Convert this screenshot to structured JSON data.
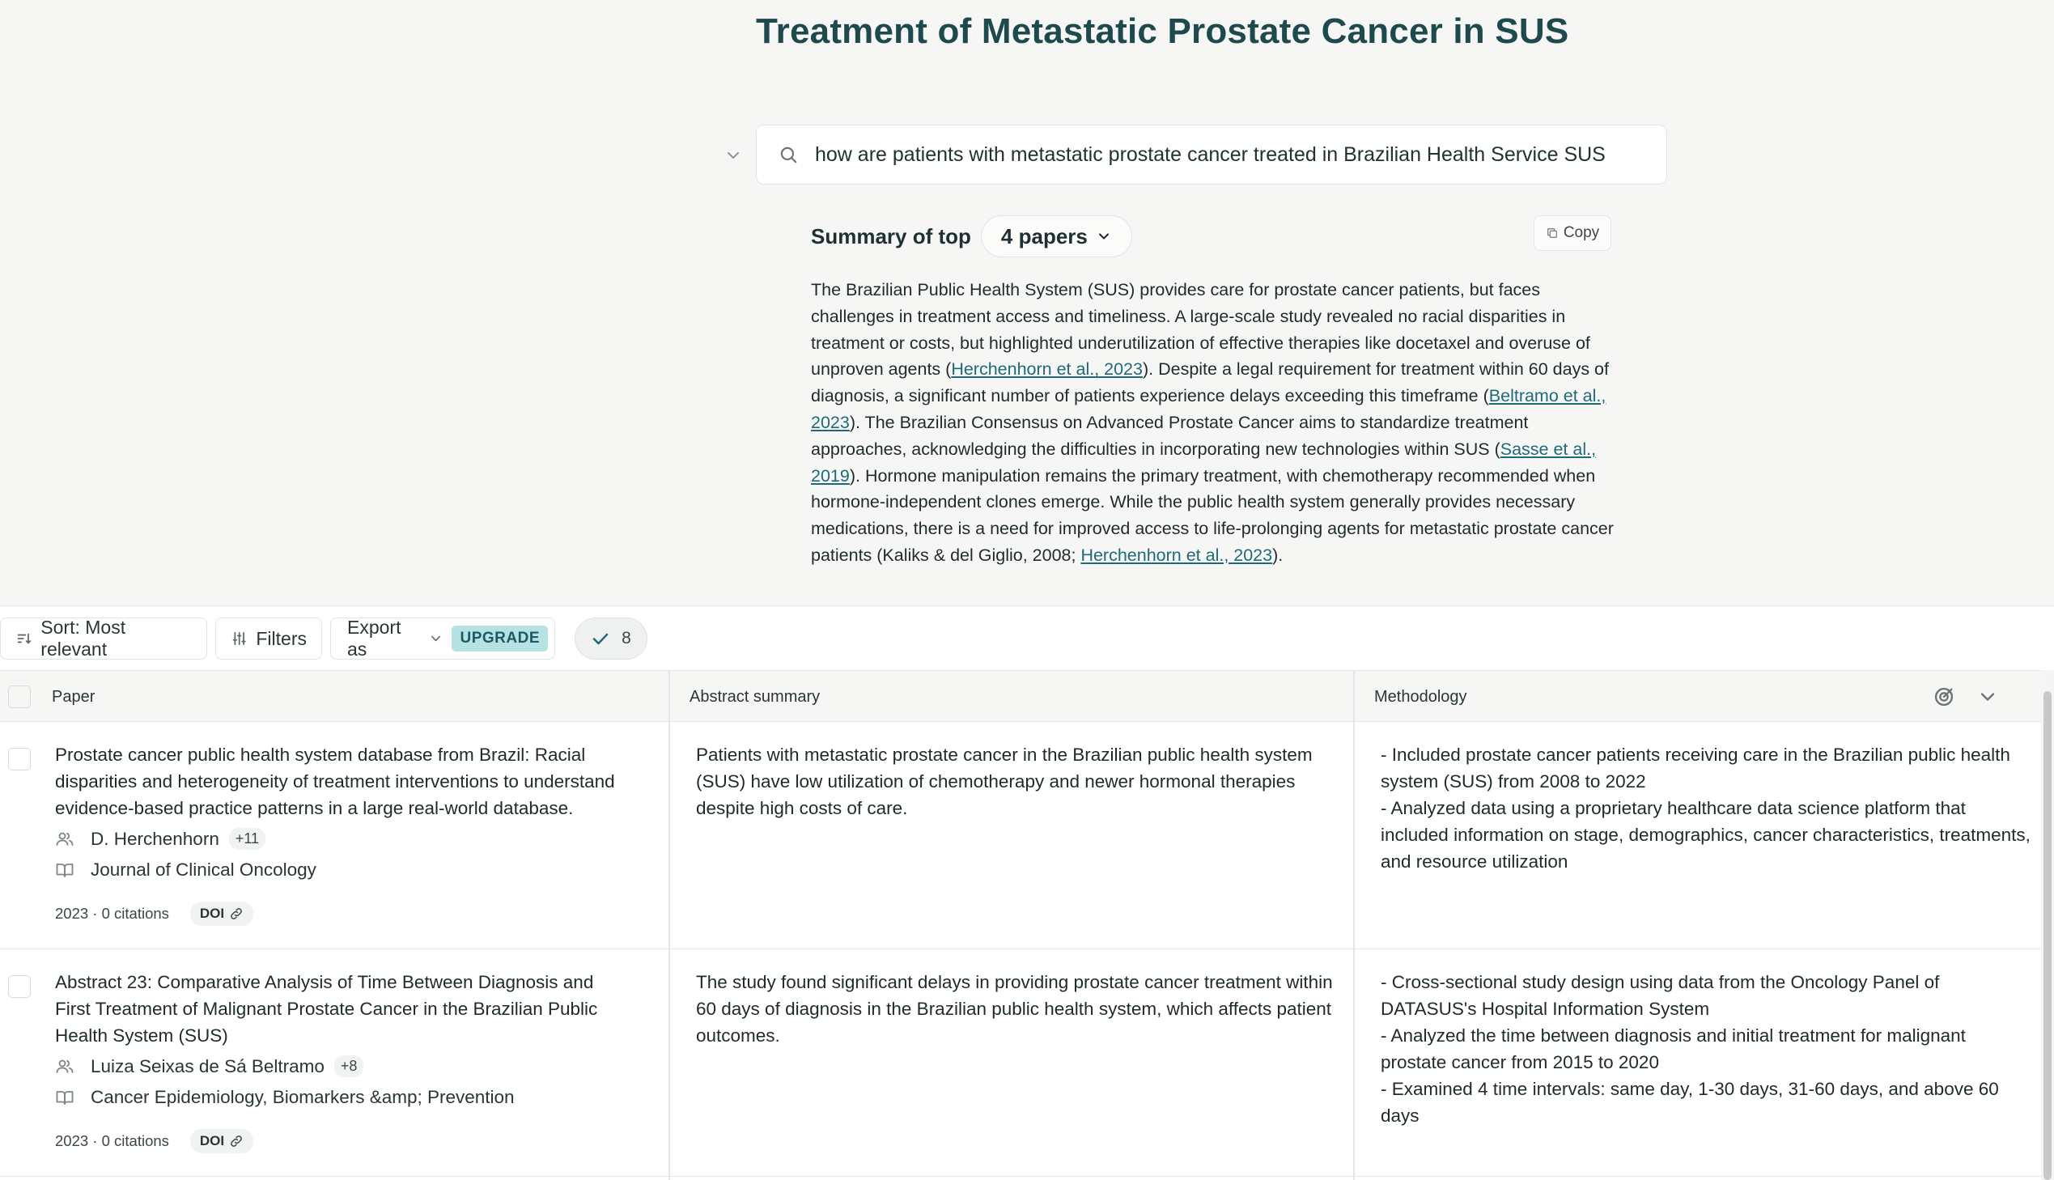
{
  "page": {
    "title": "Treatment of Metastatic Prostate Cancer in SUS"
  },
  "search": {
    "query": "how are patients with metastatic prostate cancer treated in Brazilian Health Service SUS"
  },
  "summary": {
    "label": "Summary of top",
    "papers_selector": "4 papers",
    "copy_label": "Copy",
    "parts": [
      "The Brazilian Public Health System (SUS) provides care for prostate cancer patients, but faces challenges in treatment access and timeliness. A large-scale study revealed no racial disparities in treatment or costs, but highlighted underutilization of effective therapies like docetaxel and overuse of unproven agents (",
      "Herchenhorn et al., 2023",
      "). Despite a legal requirement for treatment within 60 days of diagnosis, a significant number of patients experience delays exceeding this timeframe (",
      "Beltramo et al., 2023",
      "). The Brazilian Consensus on Advanced Prostate Cancer aims to standardize treatment approaches, acknowledging the difficulties in incorporating new technologies within SUS (",
      "Sasse et al., 2019",
      "). Hormone manipulation remains the primary treatment, with chemotherapy recommended when hormone-independent clones emerge. While the public health system generally provides necessary medications, there is a need for improved access to life-prolonging agents for metastatic prostate cancer patients (Kaliks & del Giglio, 2008; ",
      "Herchenhorn et al., 2023",
      ")."
    ]
  },
  "toolbar": {
    "sort_label": "Sort: Most relevant",
    "filters_label": "Filters",
    "export_label": "Export as",
    "upgrade_label": "UPGRADE",
    "selected_count": "8"
  },
  "table": {
    "columns": [
      "Paper",
      "Abstract summary",
      "Methodology"
    ],
    "rows": [
      {
        "title": "Prostate cancer public health system database from Brazil: Racial disparities and heterogeneity of treatment interventions to understand evidence-based practice patterns in a large real-world database.",
        "author": "D. Herchenhorn",
        "more_authors": "+11",
        "journal": "Journal of Clinical Oncology",
        "year_citations": "2023 · 0 citations",
        "doi_label": "DOI",
        "abstract": "Patients with metastatic prostate cancer in the Brazilian public health system (SUS) have low utilization of chemotherapy and newer hormonal therapies despite high costs of care.",
        "methodology": [
          "- Included prostate cancer patients receiving care in the Brazilian public health system (SUS) from 2008 to 2022",
          "- Analyzed data using a proprietary healthcare data science platform that included information on stage, demographics, cancer characteristics, treatments, and resource utilization"
        ]
      },
      {
        "title": "Abstract 23: Comparative Analysis of Time Between Diagnosis and First Treatment of Malignant Prostate Cancer in the Brazilian Public Health System (SUS)",
        "author": "Luiza Seixas de Sá Beltramo",
        "more_authors": "+8",
        "journal": "Cancer Epidemiology, Biomarkers &amp; Prevention",
        "year_citations": "2023 · 0 citations",
        "doi_label": "DOI",
        "abstract": "The study found significant delays in providing prostate cancer treatment within 60 days of diagnosis in the Brazilian public health system, which affects patient outcomes.",
        "methodology": [
          "- Cross-sectional study design using data from the Oncology Panel of DATASUS's Hospital Information System",
          "- Analyzed the time between diagnosis and initial treatment for malignant prostate cancer from 2015 to 2020",
          "- Examined 4 time intervals: same day, 1-30 days, 31-60 days, and above 60 days"
        ]
      }
    ]
  },
  "icons": {
    "collapse": "chevron-down-icon",
    "search": "search-icon",
    "copy": "copy-icon",
    "sort": "sort-icon",
    "filters": "sliders-icon",
    "export": "chevron-down-icon",
    "selected": "check-icon",
    "header_target": "target-icon",
    "header_expand": "chevron-down-icon",
    "authors": "users-icon",
    "journal": "book-icon",
    "doi": "link-icon"
  },
  "colors": {
    "accent": "#1e6a78",
    "title": "#1e4a4e",
    "upgrade_bg": "#b7e2e4",
    "background": "#f6f7f5"
  }
}
